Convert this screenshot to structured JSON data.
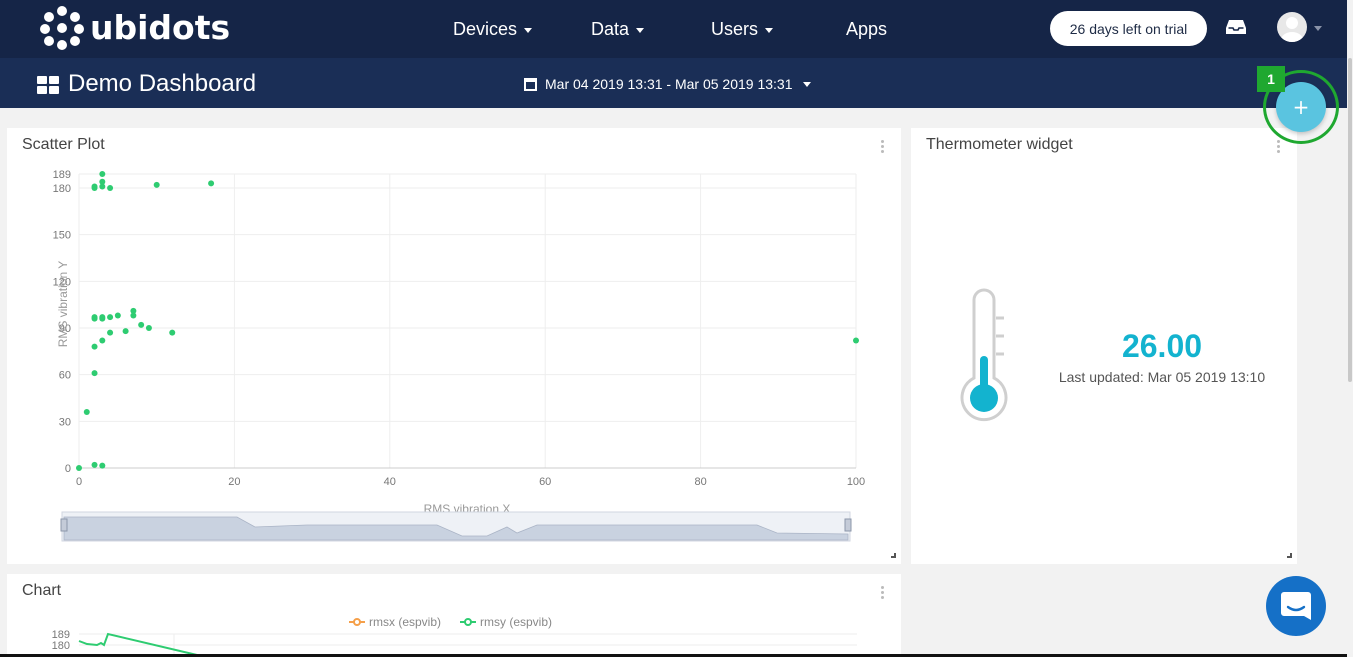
{
  "brand": {
    "name": "ubidots"
  },
  "nav": {
    "devices": "Devices",
    "data": "Data",
    "users": "Users",
    "apps": "Apps"
  },
  "trial": {
    "label": "26 days left on trial"
  },
  "dashboard": {
    "title": "Demo Dashboard",
    "date_range": "Mar 04 2019 13:31 - Mar 05 2019 13:31"
  },
  "step_badge": "1",
  "add_button": "+",
  "widgets": {
    "scatter": {
      "title": "Scatter Plot",
      "xlabel": "RMS vibration X",
      "ylabel": "RMS vibration Y"
    },
    "thermometer": {
      "title": "Thermometer widget",
      "value": "26.00",
      "updated": "Last updated: Mar 05 2019 13:10"
    },
    "chart": {
      "title": "Chart",
      "legend": [
        "rmsx  (espvib)",
        "rmsy  (espvib)"
      ],
      "y_ticks": [
        "189",
        "180"
      ]
    }
  },
  "colors": {
    "navbar": "#152547",
    "dashbar": "#1a2e56",
    "point": "#2ecc71",
    "thermo": "#13b3cf",
    "rmsx": "#f5a04a",
    "rmsy": "#2ecc71",
    "highlight": "#1fa830"
  },
  "chart_data": [
    {
      "type": "scatter",
      "title": "Scatter Plot",
      "xlabel": "RMS vibration X",
      "ylabel": "RMS vibration Y",
      "xlim": [
        0,
        100
      ],
      "ylim": [
        0,
        189
      ],
      "x_ticks": [
        0,
        20,
        40,
        60,
        80,
        100
      ],
      "y_ticks": [
        0,
        30,
        60,
        90,
        120,
        150,
        180,
        189
      ],
      "grid": true,
      "points": [
        [
          0,
          0
        ],
        [
          2,
          2
        ],
        [
          3,
          1.5
        ],
        [
          1,
          36
        ],
        [
          2,
          61
        ],
        [
          2,
          78
        ],
        [
          3,
          82
        ],
        [
          4,
          87
        ],
        [
          6,
          88
        ],
        [
          8,
          92
        ],
        [
          9,
          90
        ],
        [
          12,
          87
        ],
        [
          2,
          96
        ],
        [
          2,
          97
        ],
        [
          3,
          96
        ],
        [
          3,
          97
        ],
        [
          4,
          97
        ],
        [
          5,
          98
        ],
        [
          7,
          98
        ],
        [
          7,
          101
        ],
        [
          2,
          180
        ],
        [
          2,
          181
        ],
        [
          3,
          181
        ],
        [
          3,
          184
        ],
        [
          3,
          189
        ],
        [
          4,
          180
        ],
        [
          10,
          182
        ],
        [
          17,
          183
        ],
        [
          100,
          82
        ]
      ]
    },
    {
      "type": "line",
      "title": "Chart",
      "series": [
        {
          "name": "rmsx  (espvib)"
        },
        {
          "name": "rmsy  (espvib)"
        }
      ],
      "y_ticks": [
        180,
        189
      ]
    }
  ]
}
